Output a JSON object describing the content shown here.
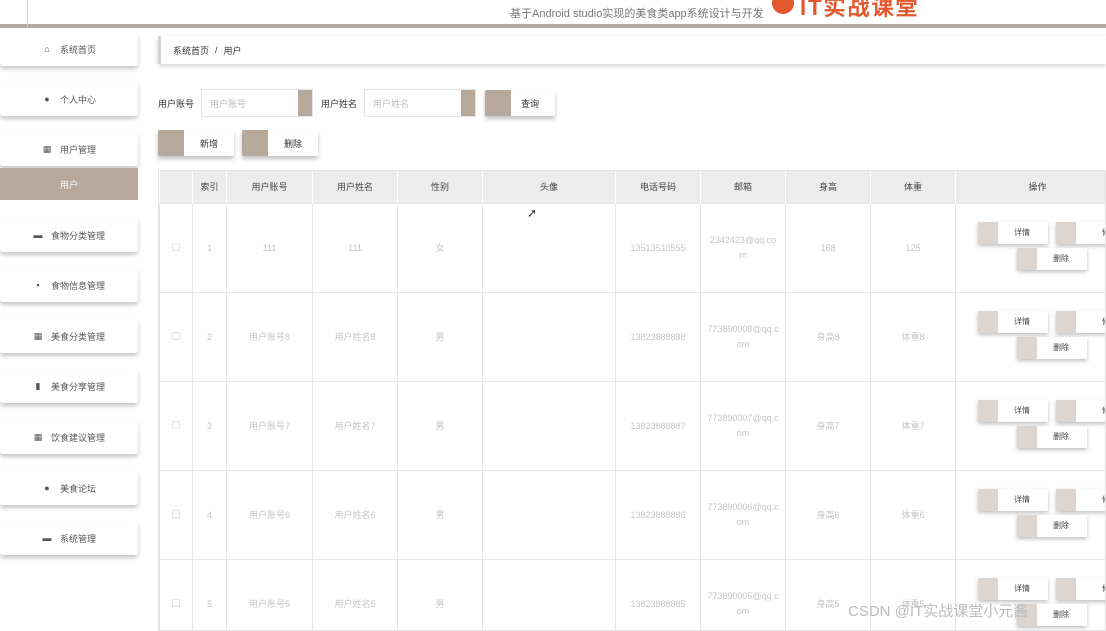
{
  "header": {
    "site_title": "基于Android studio实现的美食类app系统设计与开发",
    "logo_text": "IT实战课堂"
  },
  "sidebar": {
    "items": [
      {
        "label": "系统首页",
        "icon": "home-icon",
        "glyph": "⌂"
      },
      {
        "label": "个人中心",
        "icon": "person-icon",
        "glyph": "●"
      },
      {
        "label": "用户管理",
        "icon": "grid-icon",
        "glyph": "▦"
      },
      {
        "label": "食物分类管理",
        "icon": "briefcase-icon",
        "glyph": "▬"
      },
      {
        "label": "食物信息管理",
        "icon": "message-icon",
        "glyph": "▪"
      },
      {
        "label": "美食分类管理",
        "icon": "grid-icon",
        "glyph": "▦"
      },
      {
        "label": "美食分享管理",
        "icon": "clipboard-icon",
        "glyph": "▮"
      },
      {
        "label": "饮食建议管理",
        "icon": "grid-icon",
        "glyph": "▦"
      },
      {
        "label": "美食论坛",
        "icon": "location-pin-icon",
        "glyph": "●"
      },
      {
        "label": "系统管理",
        "icon": "monitor-icon",
        "glyph": "▬"
      }
    ],
    "active_sub": "用户"
  },
  "breadcrumb": {
    "home": "系统首页",
    "sep": "/",
    "current": "用户"
  },
  "search": {
    "account_label": "用户账号",
    "account_placeholder": "用户账号",
    "name_label": "用户姓名",
    "name_placeholder": "用户姓名",
    "query_button": "查询"
  },
  "actions": {
    "add": "新增",
    "delete": "删除"
  },
  "table": {
    "headers": [
      "",
      "索引",
      "用户账号",
      "用户姓名",
      "性别",
      "头像",
      "电话号码",
      "邮箱",
      "身高",
      "体重",
      "操作"
    ],
    "rows": [
      {
        "index": "1",
        "account": "111",
        "name": "111",
        "gender": "女",
        "avatar": "",
        "phone": "13513513555",
        "email": "2342423@qq.com",
        "height": "168",
        "weight": "125"
      },
      {
        "index": "2",
        "account": "用户账号8",
        "name": "用户姓名8",
        "gender": "男",
        "avatar": "",
        "phone": "13823888888",
        "email": "773890008@qq.com",
        "height": "身高8",
        "weight": "体重8"
      },
      {
        "index": "3",
        "account": "用户账号7",
        "name": "用户姓名7",
        "gender": "男",
        "avatar": "",
        "phone": "13823888887",
        "email": "773890007@qq.com",
        "height": "身高7",
        "weight": "体重7"
      },
      {
        "index": "4",
        "account": "用户账号6",
        "name": "用户姓名6",
        "gender": "男",
        "avatar": "",
        "phone": "13823888886",
        "email": "773890006@qq.com",
        "height": "身高6",
        "weight": "体重6"
      },
      {
        "index": "5",
        "account": "用户账号5",
        "name": "用户姓名5",
        "gender": "男",
        "avatar": "",
        "phone": "13823888885",
        "email": "773890005@qq.com",
        "height": "身高5",
        "weight": "体重5"
      }
    ],
    "op_detail": "详情",
    "op_edit": "修改",
    "op_delete": "删除"
  },
  "watermark": "CSDN @IT实战课堂小元酱",
  "colors": {
    "accent": "#b7a89c"
  }
}
